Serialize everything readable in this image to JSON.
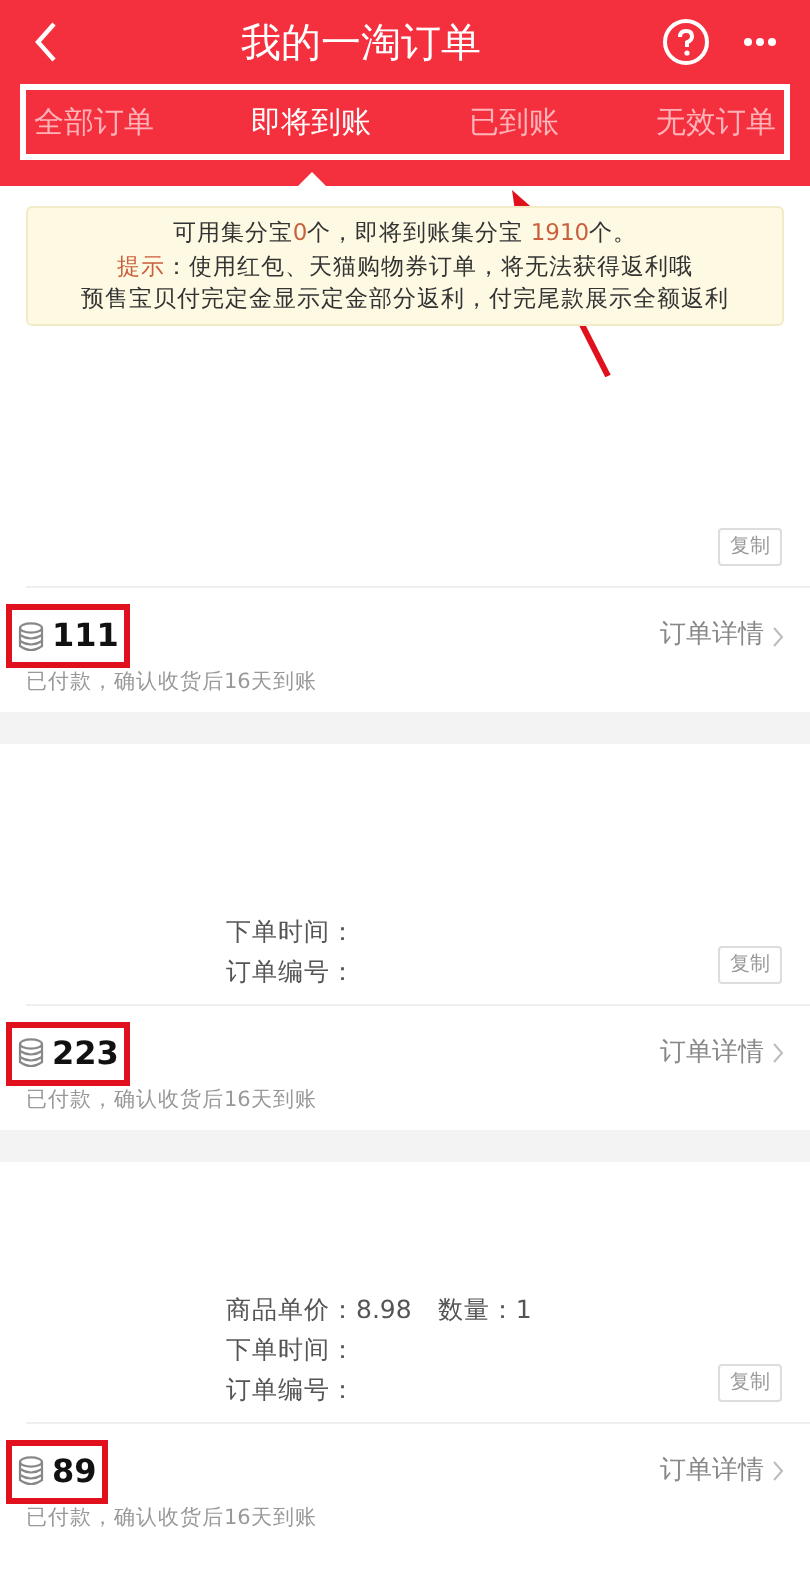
{
  "header": {
    "title": "我的一淘订单",
    "tabs_highlighted": true,
    "tabs": [
      {
        "label": "全部订单",
        "selected": false
      },
      {
        "label": "即将到账",
        "selected": true
      },
      {
        "label": "已到账",
        "selected": false
      },
      {
        "label": "无效订单",
        "selected": false
      }
    ]
  },
  "annotation_arrow": true,
  "notice": {
    "lines": [
      "可用集分宝**0**个，即将到账集分宝 **1910**个。",
      "**提示**：使用红包、天猫购物券订单，将无法获得返利哦",
      "预售宝贝付完定金显示定金部分返利，付完尾款展示全额返利"
    ]
  },
  "orders": [
    {
      "copy": "复制",
      "points": "111",
      "highlighted": true,
      "detail": "订单详情",
      "status": "已付款，确认收货后16天到账"
    },
    {
      "fields": [
        {
          "label": "下单时间："
        },
        {
          "label": "订单编号："
        }
      ],
      "copy": "复制",
      "points": "223",
      "highlighted": true,
      "detail": "订单详情",
      "status": "已付款，确认收货后16天到账"
    },
    {
      "fields": [
        {
          "label": "商品单价：8.98　数量：1"
        },
        {
          "label": "下单时间："
        },
        {
          "label": "订单编号："
        }
      ],
      "copy": "复制",
      "points": "89",
      "highlighted": true,
      "detail": "订单详情",
      "status": "已付款，确认收货后16天到账"
    }
  ]
}
